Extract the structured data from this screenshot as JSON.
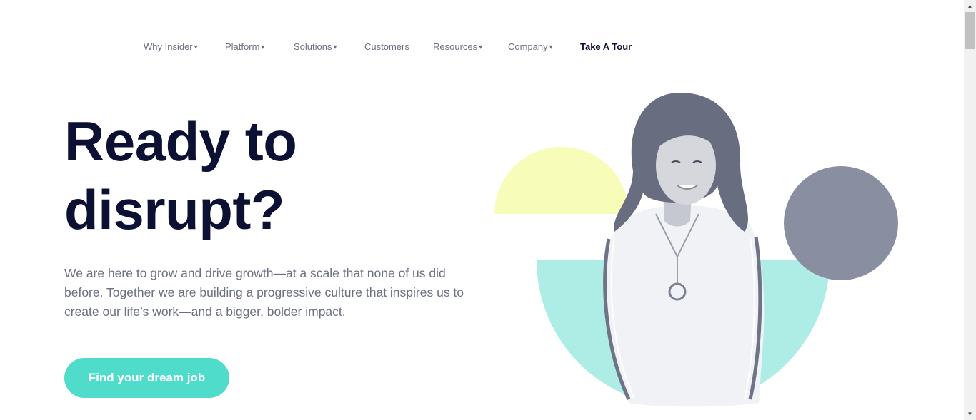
{
  "nav": {
    "items": [
      {
        "label": "Why Insider",
        "caret": "▾"
      },
      {
        "label": "Platform",
        "caret": "▾"
      },
      {
        "label": "Solutions",
        "caret": "▾"
      },
      {
        "label": "Customers",
        "caret": ""
      },
      {
        "label": "Resources",
        "caret": "▾"
      },
      {
        "label": "Company",
        "caret": "▾"
      }
    ],
    "tour_label": "Take A Tour"
  },
  "hero": {
    "title_line1": "Ready to",
    "title_line2": "disrupt?",
    "description": "We are here to grow and drive growth—at a scale that none of us did before. Together we are building a progressive culture that inspires us to create our life’s work—and a bigger, bolder impact.",
    "cta_label": "Find your dream job"
  },
  "colors": {
    "heading": "#0c1032",
    "body_text": "#6b7080",
    "cta": "#4fdccb",
    "yellow_shape": "#f7fcb9",
    "mint_shape": "#adede6",
    "gray_circle": "#8a8ea1"
  },
  "scrollbar": {
    "up_icon": "▲",
    "down_icon": "▼"
  }
}
